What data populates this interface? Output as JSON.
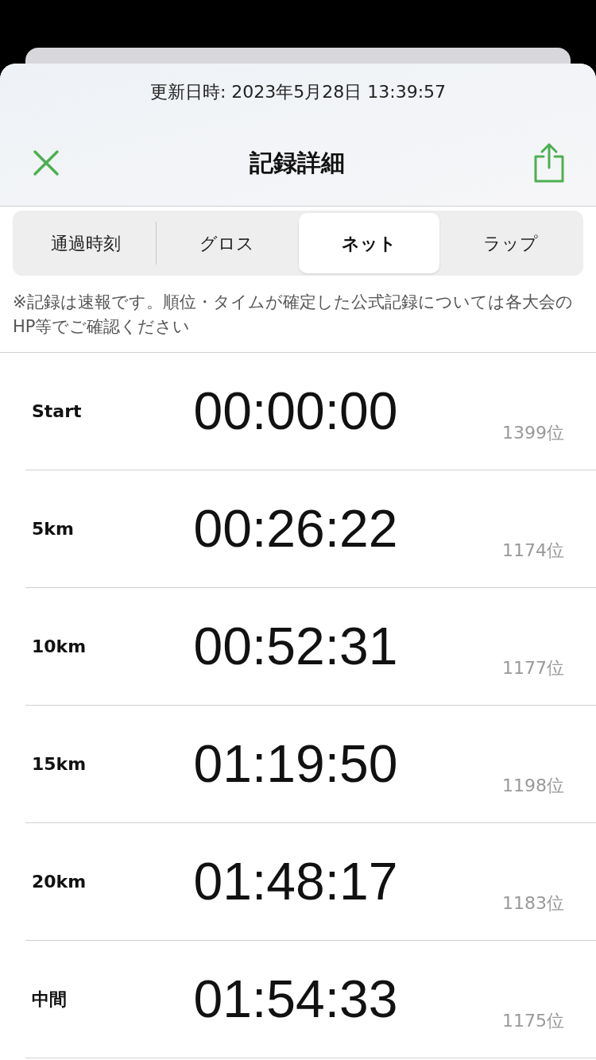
{
  "updated": "更新日時: 2023年5月28日 13:39:57",
  "title": "記録詳細",
  "tabs": [
    {
      "label": "通過時刻",
      "selected": false
    },
    {
      "label": "グロス",
      "selected": false
    },
    {
      "label": "ネット",
      "selected": true
    },
    {
      "label": "ラップ",
      "selected": false
    }
  ],
  "note": "※記録は速報です。順位・タイムが確定した公式記録については各大会のHP等でご確認ください",
  "rows": [
    {
      "label": "Start",
      "time": "00:00:00",
      "rank": "1399位"
    },
    {
      "label": "5km",
      "time": "00:26:22",
      "rank": "1174位"
    },
    {
      "label": "10km",
      "time": "00:52:31",
      "rank": "1177位"
    },
    {
      "label": "15km",
      "time": "01:19:50",
      "rank": "1198位"
    },
    {
      "label": "20km",
      "time": "01:48:17",
      "rank": "1183位"
    },
    {
      "label": "中間",
      "time": "01:54:33",
      "rank": "1175位"
    }
  ]
}
